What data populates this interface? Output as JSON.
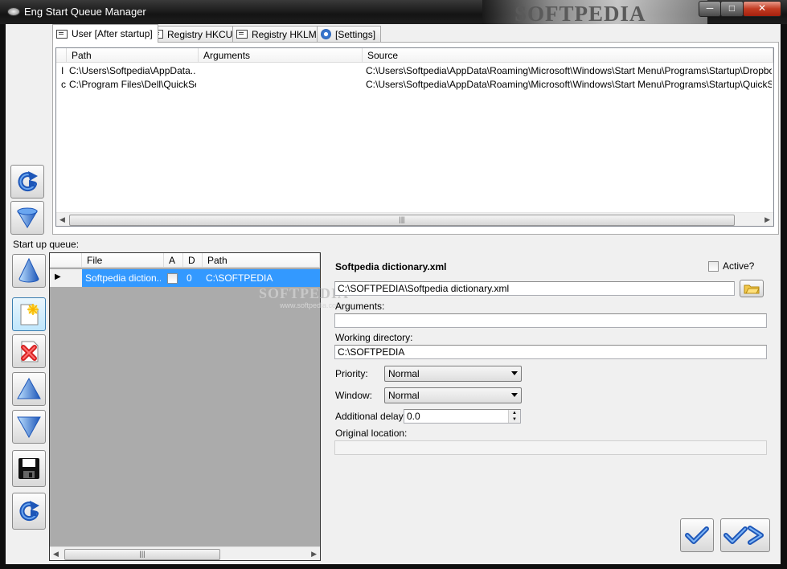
{
  "window": {
    "title": "Eng Start Queue Manager",
    "watermark": "SOFTPEDIA",
    "controls": {
      "minimize": "─",
      "maximize": "□",
      "close": "✕"
    }
  },
  "tabs": [
    {
      "label": "User [After startup]",
      "icon": "list-icon",
      "active": true
    },
    {
      "label": "Registry HKCU",
      "icon": "list-icon"
    },
    {
      "label": "Registry HKLM",
      "icon": "list-icon"
    },
    {
      "label": "[Settings]",
      "icon": "gear-icon"
    }
  ],
  "startup_list": {
    "columns": [
      "Path",
      "Arguments",
      "Source"
    ],
    "rows": [
      {
        "marker": "I",
        "path": "C:\\Users\\Softpedia\\AppData...",
        "arguments": "",
        "source": "C:\\Users\\Softpedia\\AppData\\Roaming\\Microsoft\\Windows\\Start Menu\\Programs\\Startup\\Dropbox.lnk"
      },
      {
        "marker": "c",
        "path": "C:\\Program Files\\Dell\\QuickSet",
        "arguments": "",
        "source": "C:\\Users\\Softpedia\\AppData\\Roaming\\Microsoft\\Windows\\Start Menu\\Programs\\Startup\\QuickSet.lnk"
      }
    ],
    "scroll_grip": "|||"
  },
  "queue": {
    "label": "Start up queue:",
    "columns": [
      "File",
      "A",
      "D",
      "Path"
    ],
    "rows": [
      {
        "file": "Softpedia diction...",
        "active": false,
        "delay": "0",
        "path": "C:\\SOFTPEDIA",
        "selected": true
      }
    ],
    "scroll_grip": "|||",
    "overlay_watermark": "SOFTPEDIA",
    "overlay_url": "www.softpedia.com"
  },
  "details": {
    "title": "Softpedia dictionary.xml",
    "active_label": "Active?",
    "active_checked": false,
    "file_path": "C:\\SOFTPEDIA\\Softpedia dictionary.xml",
    "arguments_label": "Arguments:",
    "arguments_value": "",
    "working_dir_label": "Working directory:",
    "working_dir_value": "C:\\SOFTPEDIA",
    "priority_label": "Priority:",
    "priority_value": "Normal",
    "window_label": "Window:",
    "window_value": "Normal",
    "delay_label": "Additional delay:",
    "delay_value": "0.0",
    "original_location_label": "Original location:",
    "original_location_value": ""
  },
  "colors": {
    "selection": "#3399ff",
    "queue_background": "#ababab",
    "client_background": "#f0f0f0",
    "icon_blue": "#2f6fd6"
  }
}
